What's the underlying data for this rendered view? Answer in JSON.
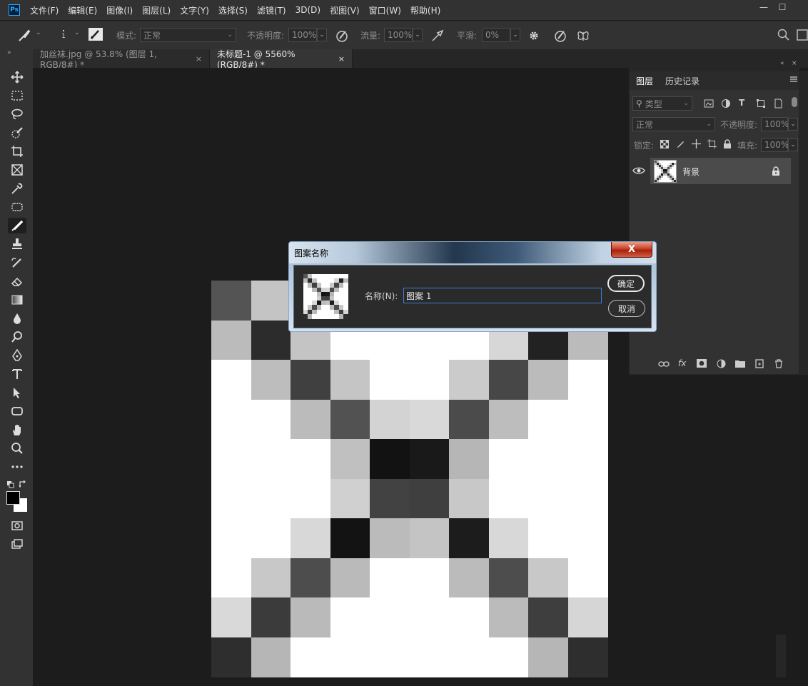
{
  "app": {
    "logo": "Ps"
  },
  "menu": [
    "文件(F)",
    "编辑(E)",
    "图像(I)",
    "图层(L)",
    "文字(Y)",
    "选择(S)",
    "滤镜(T)",
    "3D(D)",
    "视图(V)",
    "窗口(W)",
    "帮助(H)"
  ],
  "window_controls": {
    "minimize": "—",
    "maximize": "☐"
  },
  "options": {
    "brush_size": "1",
    "mode_label": "模式:",
    "mode_value": "正常",
    "opacity_label": "不透明度:",
    "opacity_value": "100%",
    "flow_label": "流量:",
    "flow_value": "100%",
    "smooth_label": "平滑:",
    "smooth_value": "0%"
  },
  "tabs": [
    {
      "label": "加丝袜.jpg @ 53.8% (图层 1, RGB/8#) *",
      "close": "×"
    },
    {
      "label": "未标题-1 @ 5560%(RGB/8#) *",
      "close": "×"
    }
  ],
  "layers_panel": {
    "tab_layers": "图层",
    "tab_history": "历史记录",
    "filter_kind": "类型",
    "blend_mode": "正常",
    "opacity_label": "不透明度:",
    "opacity_value": "100%",
    "lock_label": "锁定:",
    "fill_label": "填充:",
    "fill_value": "100%",
    "layer_name": "背景",
    "fx_label": "fx"
  },
  "dialog": {
    "title": "图案名称",
    "name_label": "名称(N):",
    "name_value": "图案 1",
    "ok_label": "确定",
    "cancel_label": "取消",
    "close_label": "X"
  },
  "pattern": {
    "rows": [
      [
        "#545454",
        "#c4c4c4",
        "#ffffff",
        "#ffffff",
        "#ffffff",
        "#ffffff",
        "#ffffff",
        "#ffffff",
        "#ffffff",
        "#ffffff"
      ],
      [
        "#bbbbbb",
        "#2c2c2c",
        "#c4c4c4",
        "#ffffff",
        "#ffffff",
        "#ffffff",
        "#ffffff",
        "#d7d7d7",
        "#222222",
        "#bbbbbb"
      ],
      [
        "#ffffff",
        "#bdbdbd",
        "#404040",
        "#c5c5c5",
        "#ffffff",
        "#ffffff",
        "#cbcbcb",
        "#474747",
        "#bbbbbb",
        "#ffffff"
      ],
      [
        "#ffffff",
        "#ffffff",
        "#bbbbbb",
        "#525252",
        "#d3d3d3",
        "#d9d9d9",
        "#4b4b4b",
        "#bdbdbd",
        "#ffffff",
        "#ffffff"
      ],
      [
        "#ffffff",
        "#ffffff",
        "#ffffff",
        "#c0c0c0",
        "#121212",
        "#191919",
        "#b6b6b6",
        "#ffffff",
        "#ffffff",
        "#ffffff"
      ],
      [
        "#ffffff",
        "#ffffff",
        "#ffffff",
        "#d0d0d0",
        "#424242",
        "#3f3f3f",
        "#c8c8c8",
        "#ffffff",
        "#ffffff",
        "#ffffff"
      ],
      [
        "#ffffff",
        "#ffffff",
        "#d8d8d8",
        "#131313",
        "#bbbbbb",
        "#c4c4c4",
        "#1c1c1c",
        "#d8d8d8",
        "#ffffff",
        "#ffffff"
      ],
      [
        "#ffffff",
        "#c8c8c8",
        "#4d4d4d",
        "#bababa",
        "#ffffff",
        "#ffffff",
        "#bbbbbb",
        "#4d4d4d",
        "#c8c8c8",
        "#ffffff"
      ],
      [
        "#d9d9d9",
        "#3b3b3b",
        "#bababa",
        "#ffffff",
        "#ffffff",
        "#ffffff",
        "#ffffff",
        "#bbbbbb",
        "#3e3e3e",
        "#d6d6d6"
      ],
      [
        "#2e2e2e",
        "#b6b6b6",
        "#ffffff",
        "#ffffff",
        "#ffffff",
        "#ffffff",
        "#ffffff",
        "#ffffff",
        "#b6b6b6",
        "#2e2e2e"
      ]
    ]
  }
}
